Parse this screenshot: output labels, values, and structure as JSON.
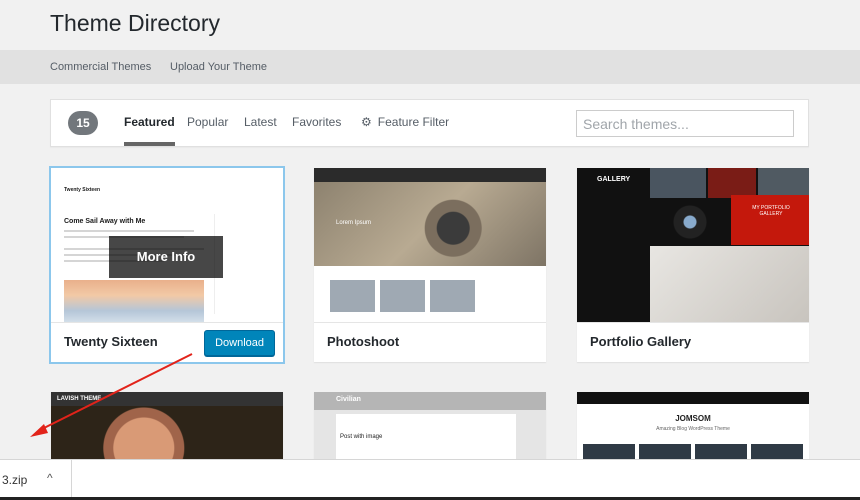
{
  "page": {
    "title": "Theme Directory"
  },
  "subnav": {
    "commercial": "Commercial Themes",
    "upload": "Upload Your Theme"
  },
  "filter": {
    "count": "15",
    "tabs": {
      "featured": "Featured",
      "popular": "Popular",
      "latest": "Latest",
      "favorites": "Favorites"
    },
    "feature_filter": "Feature Filter",
    "search_placeholder": "Search themes..."
  },
  "themes": [
    {
      "name": "Twenty Sixteen",
      "download": "Download",
      "more_info": "More Info",
      "shot": {
        "site_title": "Twenty Sixteen",
        "hero": "Come Sail Away with Me"
      }
    },
    {
      "name": "Photoshoot",
      "shot": {
        "hero": "Lorem Ipsum"
      }
    },
    {
      "name": "Portfolio Gallery",
      "shot": {
        "logo": "GALLERY",
        "panel": "MY PORTFOLIO GALLERY"
      }
    },
    {
      "shot": {
        "logo": "LAVISH THEME"
      }
    },
    {
      "shot": {
        "logo": "Civilian",
        "post": "Post with image"
      }
    },
    {
      "shot": {
        "title": "JOMSOM",
        "subtitle": "Amazing Blog WordPress Theme"
      }
    }
  ],
  "download_bar": {
    "file": "3.zip"
  },
  "colors": {
    "primary": "#0085ba",
    "annotation": "#e2231a"
  }
}
